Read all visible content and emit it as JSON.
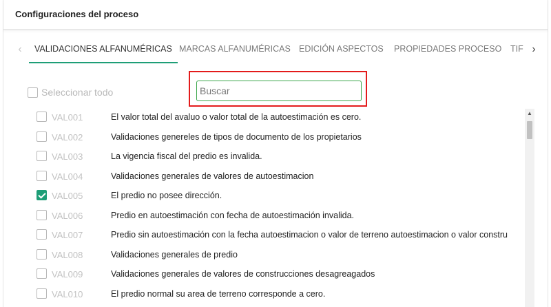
{
  "header": {
    "title": "Configuraciones del proceso"
  },
  "tabs": {
    "prev_icon": "chevron-left-icon",
    "next_icon": "chevron-right-icon",
    "items": [
      {
        "label": "VALIDACIONES ALFANUMÉRICAS",
        "active": true
      },
      {
        "label": "MARCAS ALFANUMÉRICAS",
        "active": false
      },
      {
        "label": "EDICIÓN ASPECTOS",
        "active": false
      },
      {
        "label": "PROPIEDADES PROCESO",
        "active": false
      },
      {
        "label": "TIF",
        "active": false
      }
    ]
  },
  "select_all": {
    "label": "Seleccionar todo",
    "checked": false
  },
  "search": {
    "placeholder": "Buscar",
    "value": ""
  },
  "validations": [
    {
      "code": "VAL001",
      "description": "El valor total del avaluo o valor total de la autoestimación es cero.",
      "checked": false
    },
    {
      "code": "VAL002",
      "description": "Validaciones genereles de tipos de documento de los propietarios",
      "checked": false
    },
    {
      "code": "VAL003",
      "description": "La vigencia fiscal del predio es invalida.",
      "checked": false
    },
    {
      "code": "VAL004",
      "description": "Validaciones generales de valores de autoestimacion",
      "checked": false
    },
    {
      "code": "VAL005",
      "description": "El predio no posee dirección.",
      "checked": true
    },
    {
      "code": "VAL006",
      "description": "Predio en autoestimación con fecha de autoestimación invalida.",
      "checked": false
    },
    {
      "code": "VAL007",
      "description": "Predio sin autoestimación con la fecha autoestimacion o valor de terreno autoestimacion o valor constru",
      "checked": false
    },
    {
      "code": "VAL008",
      "description": "Validaciones generales de predio",
      "checked": false
    },
    {
      "code": "VAL009",
      "description": "Validaciones generales de valores de construcciones desagreagados",
      "checked": false
    },
    {
      "code": "VAL010",
      "description": "El predio normal su area de terreno corresponde a cero.",
      "checked": false
    }
  ],
  "colors": {
    "accent": "#1e9e77",
    "highlight": "#e31b1b",
    "search_border": "#3aa64a"
  }
}
